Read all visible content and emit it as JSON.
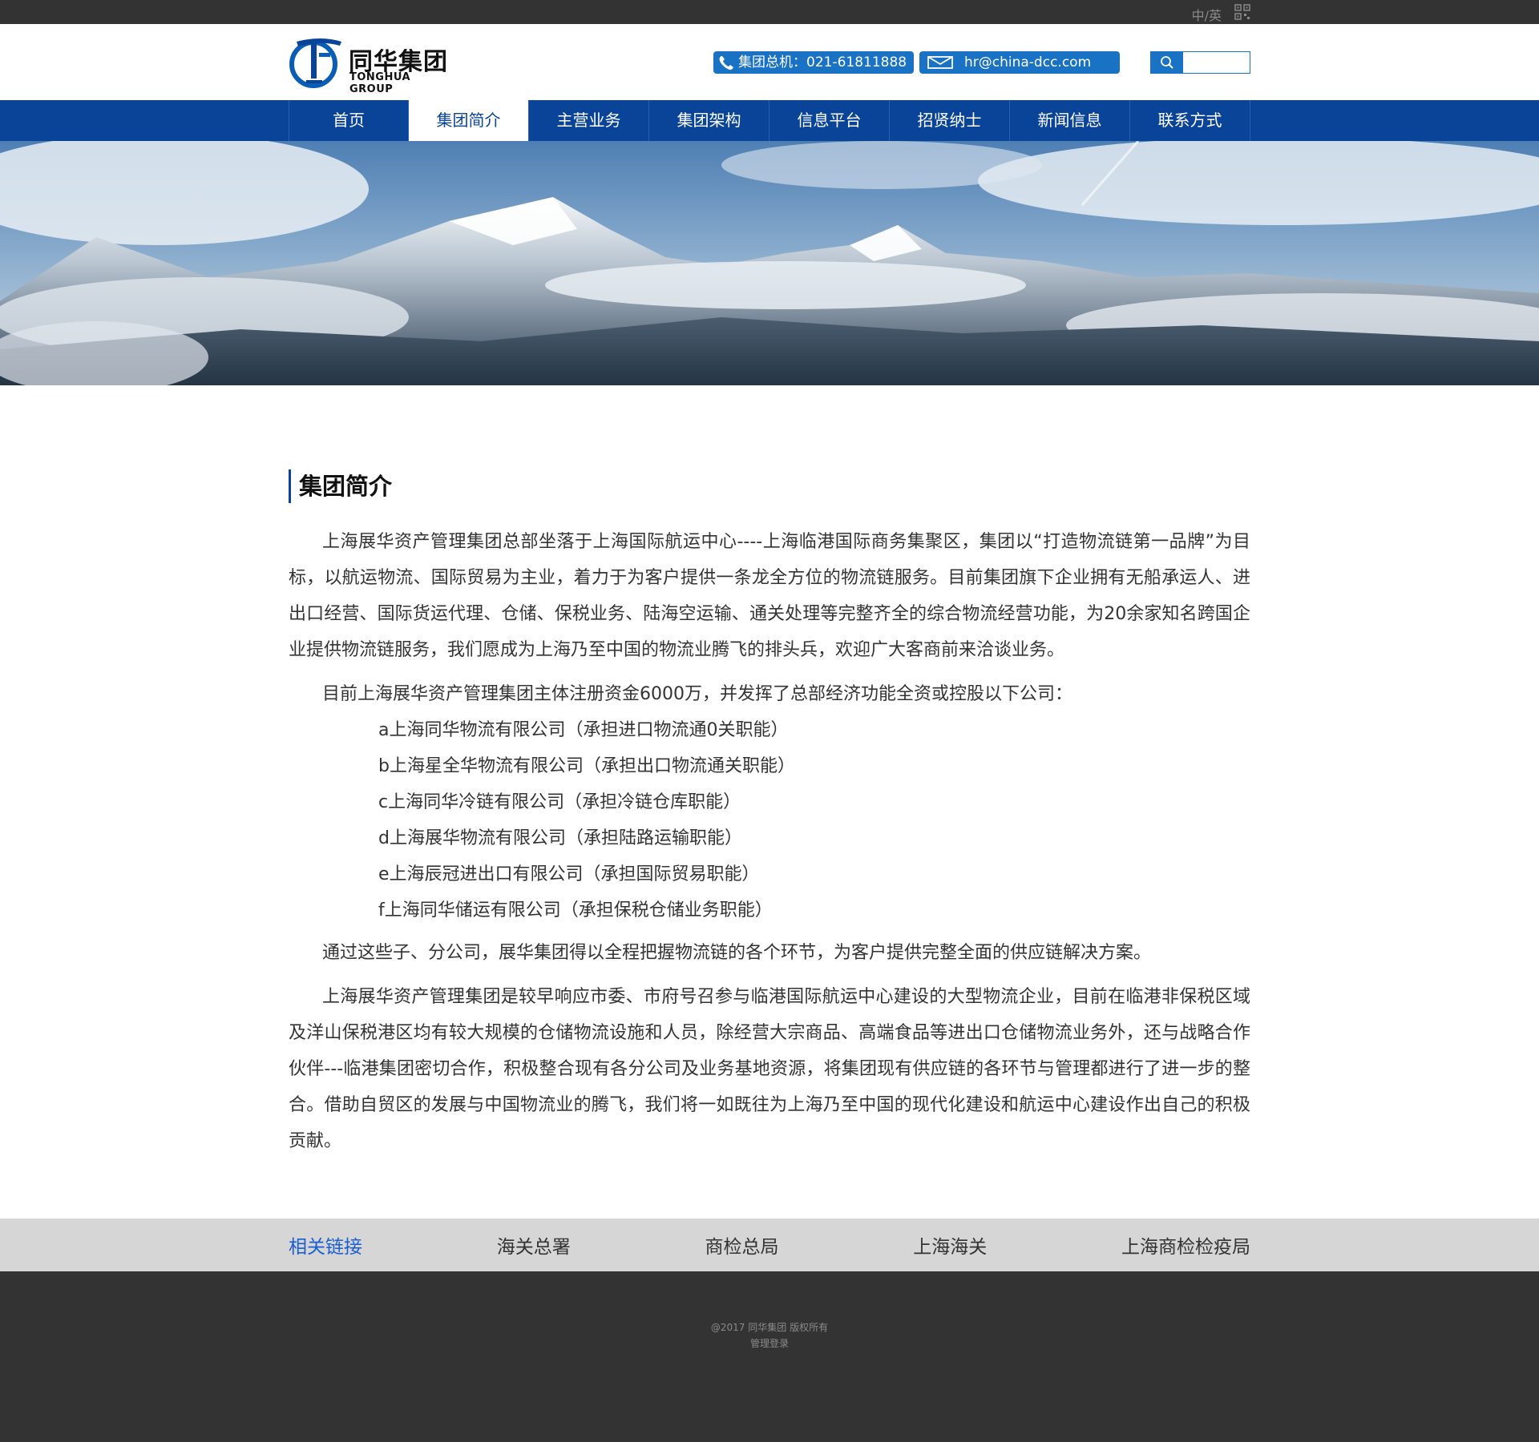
{
  "topbar": {
    "lang": "中/英"
  },
  "header": {
    "logo_cn": "同华集团",
    "logo_en": "TONGHUA GROUP",
    "phone": "集团总机：021-61811888",
    "email": "hr@china-dcc.com",
    "search_placeholder": ""
  },
  "nav": {
    "items": [
      {
        "label": "首页"
      },
      {
        "label": "集团简介"
      },
      {
        "label": "主营业务"
      },
      {
        "label": "集团架构"
      },
      {
        "label": "信息平台"
      },
      {
        "label": "招贤纳士"
      },
      {
        "label": "新闻信息"
      },
      {
        "label": "联系方式"
      }
    ],
    "active_index": 1
  },
  "main": {
    "title": "集团简介",
    "p1": "上海展华资产管理集团总部坐落于上海国际航运中心----上海临港国际商务集聚区，集团以“打造物流链第一品牌”为目标，以航运物流、国际贸易为主业，着力于为客户提供一条龙全方位的物流链服务。目前集团旗下企业拥有无船承运人、进出口经营、国际货运代理、仓储、保税业务、陆海空运输、通关处理等完整齐全的综合物流经营功能，为20余家知名跨国企业提供物流链服务，我们愿成为上海乃至中国的物流业腾飞的排头兵，欢迎广大客商前来洽谈业务。",
    "p2": "目前上海展华资产管理集团主体注册资金6000万，并发挥了总部经济功能全资或控股以下公司：",
    "companies": [
      "a上海同华物流有限公司（承担进口物流通0关职能）",
      "b上海星全华物流有限公司（承担出口物流通关职能）",
      "c上海同华冷链有限公司（承担冷链仓库职能）",
      "d上海展华物流有限公司（承担陆路运输职能）",
      "e上海辰冠进出口有限公司（承担国际贸易职能）",
      "f上海同华储运有限公司（承担保税仓储业务职能）"
    ],
    "p3": "通过这些子、分公司，展华集团得以全程把握物流链的各个环节，为客户提供完整全面的供应链解决方案。",
    "p4": "上海展华资产管理集团是较早响应市委、市府号召参与临港国际航运中心建设的大型物流企业，目前在临港非保税区域及洋山保税港区均有较大规模的仓储物流设施和人员，除经营大宗商品、高端食品等进出口仓储物流业务外，还与战略合作伙伴---临港集团密切合作，积极整合现有各分公司及业务基地资源，将集团现有供应链的各环节与管理都进行了进一步的整合。借助自贸区的发展与中国物流业的腾飞，我们将一如既往为上海乃至中国的现代化建设和航运中心建设作出自己的积极贡献。"
  },
  "links": {
    "label": "相关链接",
    "items": [
      "海关总署",
      "商检总局",
      "上海海关",
      "上海商检检疫局"
    ]
  },
  "footer": {
    "copyright": "@2017 同华集团  版权所有",
    "admin": "管理登录"
  },
  "colors": {
    "nav_bg": "#0a4499",
    "accent": "#1a72c4",
    "topbar_bg": "#333333",
    "links_bar_bg": "#d6d6d6"
  }
}
